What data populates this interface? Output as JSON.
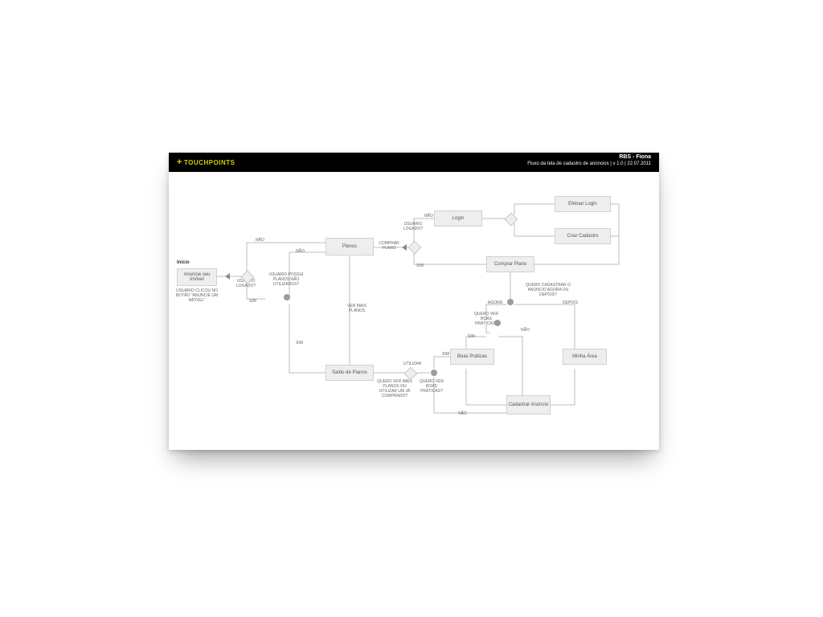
{
  "header": {
    "brand": "TOUCHPOINTS",
    "project": "RBS - Fiona",
    "subtitle": "Fluxo da tela de cadastro de anúncios | v 1.0 | 22.07.2011"
  },
  "labels": {
    "inicio": "Início",
    "anuncie": "Anuncie seu Imóvel",
    "anuncie_note": "USUÁRIO CLICOU NO BOTÃO \"ANUNCIE UM IMÓVEL\"",
    "usuario_logado": "USUÁRIO LOGADO?",
    "nao1": "NÃO",
    "sim1": "SIM",
    "possui_planos": "USUÁRIO POSSUI PLANOS NÃO UTILIZADOS?",
    "nao2": "NÃO",
    "sim2": "SIM",
    "planos": "Planos",
    "comprar_plano_lbl": "COMPRAR PLANO",
    "usuario_logado2": "USUÁRIO LOGADO?",
    "nao3": "NÃO",
    "sim3": "SIM",
    "login": "Login",
    "efetuar_login": "Efetuar Login",
    "criar_cadastro": "Criar Cadastro",
    "comprar_plano": "Comprar Plano",
    "ver_mais_planos": "VER MAIS PLANOS",
    "saldo_planos": "Saldo de Planos",
    "utilizar": "UTILIZAR",
    "q_ver_mais": "QUERO VER MAIS PLANOS OU UTILIZAR UM JÁ COMPRADO?",
    "q_boas1": "QUERO VER BOAS PRÁTICAS?",
    "q_boas2": "QUERO VER BOAS PRÁTICAS?",
    "sim4": "SIM",
    "nao4": "NÃO",
    "sim5": "SIM",
    "nao5": "NÃO",
    "boas_praticas": "Boas Práticas",
    "cadastrar_anuncio": "Cadastrar Anúncio",
    "minha_area": "Minha Área",
    "quero_cadastrar": "QUERO CADASTRAR O ANÚNCIO AGORA OU DEPOIS?",
    "agora": "AGORA",
    "depois": "DEPOIS"
  }
}
